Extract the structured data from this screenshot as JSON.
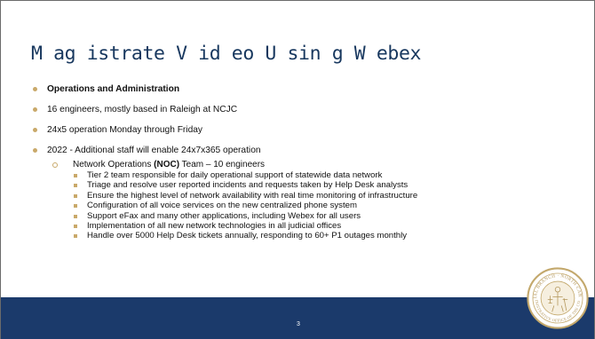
{
  "slide": {
    "title": "M ag istrate V id eo U sin g W ebex",
    "page_number": "3",
    "bullets": [
      {
        "text": "Operations and Administration",
        "bold": true
      },
      {
        "text": "16 engineers, mostly based in Raleigh at NCJC"
      },
      {
        "text": "24x5 operation Monday through Friday"
      },
      {
        "text": "2022 - Additional staff will enable 24x7x365 operation"
      }
    ],
    "sub_bullet": {
      "prefix": "Network Operations ",
      "bold": "(NOC)",
      "suffix": " Team – 10 engineers"
    },
    "sub_items": [
      "Tier 2 team responsible for daily operational support of statewide data network",
      "Triage and resolve user reported incidents and requests taken by Help Desk analysts",
      "Ensure the highest level of network availability with real time monitoring of infrastructure",
      "Configuration of all voice services on the new centralized phone system",
      "Support eFax and many other applications, including Webex for all users",
      "Implementation of all new network technologies in all judicial offices",
      "Handle over 5000 Help Desk tickets annually, responding to 60+ P1 outages monthly"
    ],
    "seal": {
      "top_text": "JUDICIAL BRANCH · NORTH CAROLINA",
      "bottom_text": "ADMINISTRATIVE OFFICE OF THE COURTS"
    },
    "colors": {
      "title": "#17375e",
      "bullet": "#c9a96a",
      "footer": "#1b3a6b",
      "seal_ring": "#c3a86c"
    }
  }
}
